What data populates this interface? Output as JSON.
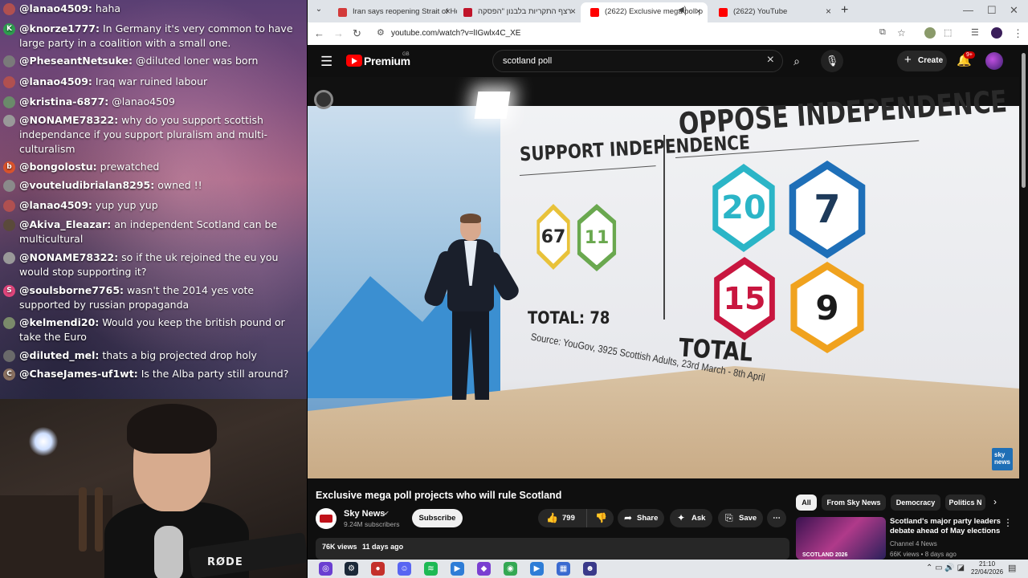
{
  "chat": {
    "messages": [
      {
        "user": "@lanao4509:",
        "text": "haha",
        "emote": "",
        "avatar_color": "#b05050",
        "avatar_letter": ""
      },
      {
        "user": "@knorze1777:",
        "text": "In Germany it's very common to have large party in a coalition with a small one.",
        "emote": "",
        "avatar_color": "#2e9e4f",
        "avatar_letter": "K"
      },
      {
        "user": "@PheseantNetsuke:",
        "text": "@diluted loner was born",
        "emote": "",
        "avatar_color": "#7a7a7a",
        "avatar_letter": ""
      },
      {
        "user": "@lanao4509:",
        "text": "Iraq war ruined labour",
        "emote": "",
        "avatar_color": "#b05050",
        "avatar_letter": ""
      },
      {
        "user": "@kristina-6877:",
        "text": "@lanao4509",
        "emote": "",
        "avatar_color": "#6a8a6a",
        "avatar_letter": ""
      },
      {
        "user": "@NONAME78322:",
        "text": "why do you support scottish independance if you support pluralism and multi-culturalism",
        "emote": "",
        "avatar_color": "#999999",
        "avatar_letter": ""
      },
      {
        "user": "@bongolostu:",
        "text": "prewatched",
        "emote": "",
        "avatar_color": "#d9532c",
        "avatar_letter": "b"
      },
      {
        "user": "@vouteludibrialan8295:",
        "text": "owned !!",
        "emote": "",
        "avatar_color": "#8a8a8a",
        "avatar_letter": ""
      },
      {
        "user": "@lanao4509:",
        "text": "yup yup yup",
        "emote": "",
        "avatar_color": "#b05050",
        "avatar_letter": ""
      },
      {
        "user": "@Akiva_Eleazar:",
        "text": "an independent Scotland can be multicultural",
        "emote": "",
        "avatar_color": "#5a4a3a",
        "avatar_letter": ""
      },
      {
        "user": "@NONAME78322:",
        "text": "so if the uk rejoined the eu you would stop supporting it?",
        "emote": "",
        "avatar_color": "#999999",
        "avatar_letter": ""
      },
      {
        "user": "@soulsborne7765:",
        "text": "wasn't the 2014 yes vote supported by russian propaganda",
        "emote": "",
        "avatar_color": "#e0457b",
        "avatar_letter": "S"
      },
      {
        "user": "@kelmendi20:",
        "text": "Would you keep the british pound or take the Euro",
        "emote": "",
        "avatar_color": "#7a8a6a",
        "avatar_letter": ""
      },
      {
        "user": "@diluted_mel:",
        "text": "thats a big projected drop holy",
        "emote": "",
        "avatar_color": "#6a6a6a",
        "avatar_letter": ""
      },
      {
        "user": "@ChaseJames-uf1wt:",
        "text": "Is the Alba party still around?",
        "emote": "",
        "avatar_color": "#8a7060",
        "avatar_letter": "C"
      }
    ]
  },
  "webcam": {
    "brand": "RØDE"
  },
  "browser": {
    "tabs": [
      {
        "title": "Iran says reopening Strait of Ho",
        "color": "#d33a3a"
      },
      {
        "title": "רצף התקריות בלבנון \"הפסקה",
        "color": "#c0142a"
      },
      {
        "title": "(2622) Exclusive mega poll p",
        "color": "#ff0000"
      },
      {
        "title": "(2622) YouTube",
        "color": "#ff0000"
      }
    ],
    "url": "youtube.com/watch?v=lIGwlx4C_XE"
  },
  "youtube": {
    "brand": "Premium",
    "region": "GB",
    "search_query": "scotland poll",
    "create_label": "Create",
    "notifications": "9+",
    "video": {
      "title": "Exclusive mega poll projects who will rule Scotland",
      "channel": "Sky News",
      "subscribers": "9.24M subscribers",
      "subscribe_label": "Subscribe",
      "likes": "799",
      "share_label": "Share",
      "ask_label": "Ask",
      "save_label": "Save",
      "views": "76K views",
      "age": "11 days ago"
    },
    "chips": [
      "All",
      "From Sky News",
      "Democracy",
      "Politics N"
    ],
    "recommendation": {
      "title": "Scotland's major party leaders debate ahead of May elections",
      "channel": "Channel 4 News",
      "stats": "66K views • 8 days ago",
      "thumb_text": "SCOTLAND 2026"
    }
  },
  "screen": {
    "support_heading": "SUPPORT INDEPENDENCE",
    "oppose_heading": "OPPOSE INDEPENDENCE",
    "support_values": [
      {
        "value": "67",
        "color": "#e8c23a",
        "text_color": "#2a2a2a"
      },
      {
        "value": "11",
        "color": "#6aa84f",
        "text_color": "#6aa84f"
      }
    ],
    "oppose_values": [
      {
        "value": "20",
        "color": "#2bb5c7",
        "text_color": "#2bb5c7"
      },
      {
        "value": "7",
        "color": "#1e6fb8",
        "text_color": "#1e3a5a"
      },
      {
        "value": "15",
        "color": "#c8163f",
        "text_color": "#c8163f"
      },
      {
        "value": "9",
        "color": "#f0a21e",
        "text_color": "#1a1a1a"
      }
    ],
    "total_left": "TOTAL: 78",
    "total_right": "TOTAL",
    "source": "Source: YouGov, 3925 Scottish Adults, 23rd March - 8th April",
    "logo_text": "sky news"
  },
  "taskbar": {
    "time": "21:10",
    "date": "22/04/2026"
  }
}
